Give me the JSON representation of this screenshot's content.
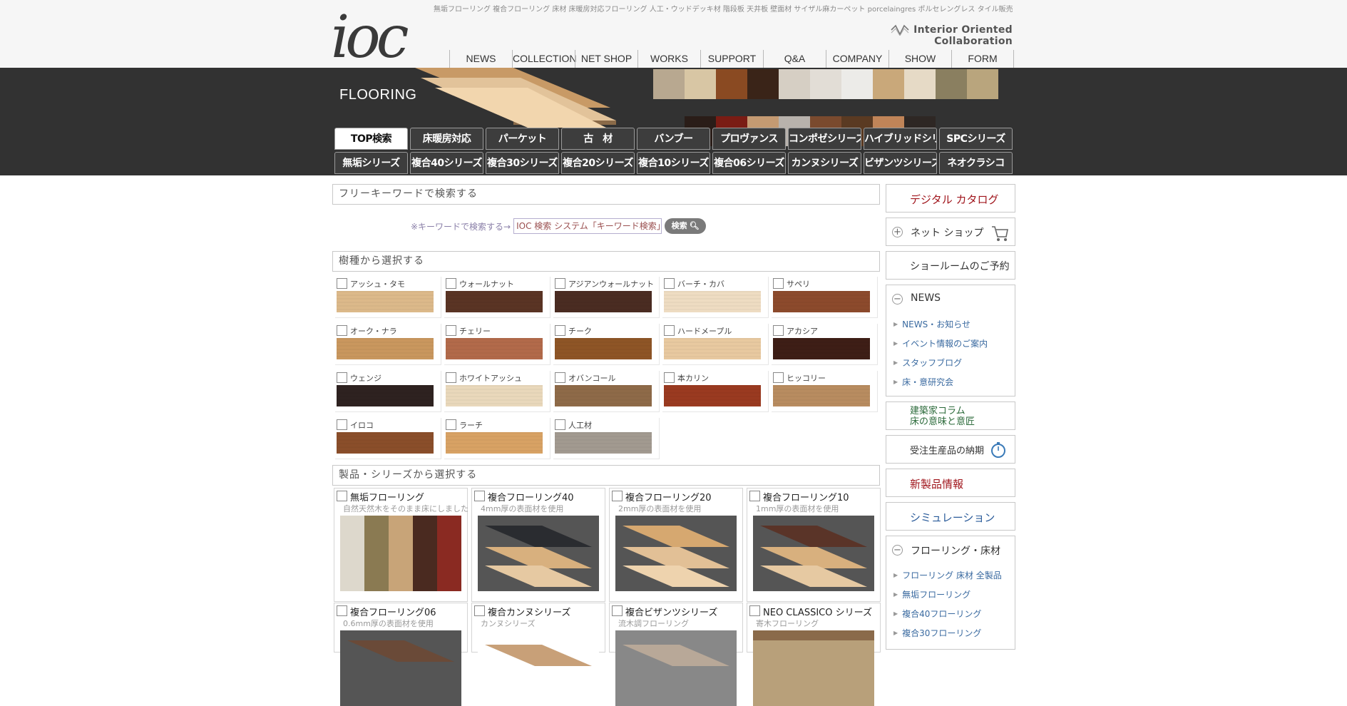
{
  "header": {
    "logo_text": "ioc",
    "seo_line": "無垢フローリング 複合フローリング 床材 床暖房対応フローリング 人工・ウッドデッキ材 階段板 天井板 壁面材 サイザル麻カーペット porcelaingres ポルセレングレス タイル販売",
    "tagline": "Interior Oriented Collaboration",
    "nav": [
      "NEWS",
      "COLLECTION",
      "NET SHOP",
      "WORKS",
      "SUPPORT",
      "Q&A",
      "COMPANY",
      "SHOW ROOM",
      "FORM"
    ]
  },
  "hero": {
    "title": "FLOORING",
    "tabs_row1": [
      "TOP検索",
      "床暖房対応",
      "パーケット",
      "古　材",
      "バンブー",
      "プロヴァンス",
      "コンポゼシリーズ",
      "ハイブリッドシリーズ",
      "SPCシリーズ"
    ],
    "tabs_row2": [
      "無垢シリーズ",
      "複合40シリーズ",
      "複合30シリーズ",
      "複合20シリーズ",
      "複合10シリーズ",
      "複合06シリーズ",
      "カンヌシリーズ",
      "ビザンツシリーズ",
      "ネオクラシコ"
    ],
    "strip_top_colors": [
      "#b8a890",
      "#d8c6a4",
      "#8a4a22",
      "#3a2418",
      "#d6cfc4",
      "#e2ddd6",
      "#ecebe8",
      "#c9a87a",
      "#e6dac6",
      "#8a7f60",
      "#b9a57d"
    ],
    "strip_bot_colors": [
      "#2a1d18",
      "#7a1c14",
      "#c49a72",
      "#b8b2ac",
      "#7a4a2e",
      "#5a3a22",
      "#c08458",
      "#2e2724"
    ]
  },
  "main": {
    "keyword_section_title": "フリーキーワードで検索する",
    "keyword_hint": "※キーワードで検索する→",
    "keyword_input_value": "IOC 検索 システム「キーワード検索」",
    "keyword_button": "検索",
    "wood_section_title": "樹種から選択する",
    "woods": [
      {
        "name": "アッシュ・タモ",
        "color": "#dcb98a"
      },
      {
        "name": "ウォールナット",
        "color": "#5a3424"
      },
      {
        "name": "アジアンウォールナット",
        "color": "#4a2c22"
      },
      {
        "name": "バーチ・カバ",
        "color": "#eedcc2"
      },
      {
        "name": "サペリ",
        "color": "#8c4a2c"
      },
      {
        "name": "オーク・ナラ",
        "color": "#c9975e"
      },
      {
        "name": "チェリー",
        "color": "#b26a4a"
      },
      {
        "name": "チーク",
        "color": "#8e5526"
      },
      {
        "name": "ハードメープル",
        "color": "#e8c9a0"
      },
      {
        "name": "アカシア",
        "color": "#3e1e16"
      },
      {
        "name": "ウェンジ",
        "color": "#2e2220"
      },
      {
        "name": "ホワイトアッシュ",
        "color": "#e9d8bb"
      },
      {
        "name": "オバンコール",
        "color": "#8e6a48"
      },
      {
        "name": "本カリン",
        "color": "#9a3a20"
      },
      {
        "name": "ヒッコリー",
        "color": "#b88c60"
      },
      {
        "name": "イロコ",
        "color": "#8a4e2a"
      },
      {
        "name": "ラーチ",
        "color": "#d8a264"
      },
      {
        "name": "人工材",
        "color": "#a29a90"
      }
    ],
    "product_section_title": "製品・シリーズから選択する",
    "products": [
      {
        "name": "無垢フローリング",
        "sub": "自然天然木をそのまま床にしました"
      },
      {
        "name": "複合フローリング40",
        "sub": "4mm厚の表面材を使用"
      },
      {
        "name": "複合フローリング20",
        "sub": "2mm厚の表面材を使用"
      },
      {
        "name": "複合フローリング10",
        "sub": "1mm厚の表面材を使用"
      },
      {
        "name": "複合フローリング06",
        "sub": "0.6mm厚の表面材を使用"
      },
      {
        "name": "複合カンヌシリーズ",
        "sub": "カンヌシリーズ"
      },
      {
        "name": "複合ビザンツシリーズ",
        "sub": "流木調フローリング"
      },
      {
        "name": "NEO CLASSICO シリーズ",
        "sub": "寄木フローリング"
      }
    ]
  },
  "sidebar": {
    "catalog": "デジタル カタログ",
    "netshop": "ネット ショップ",
    "showroom": "ショールームのご予約",
    "news_title": "NEWS",
    "news_links": [
      "NEWS・お知らせ",
      "イベント情報のご案内",
      "スタッフブログ",
      "床・意研究会"
    ],
    "column_line1": "建築家コラム",
    "column_line2": "床の意味と意匠",
    "delivery": "受注生産品の納期",
    "new_products": "新製品情報",
    "simulation": "シミュレーション",
    "flooring_title": "フローリング・床材",
    "flooring_links": [
      "フローリング 床材 全製品",
      "無垢フローリング",
      "複合40フローリング",
      "複合30フローリング"
    ]
  }
}
